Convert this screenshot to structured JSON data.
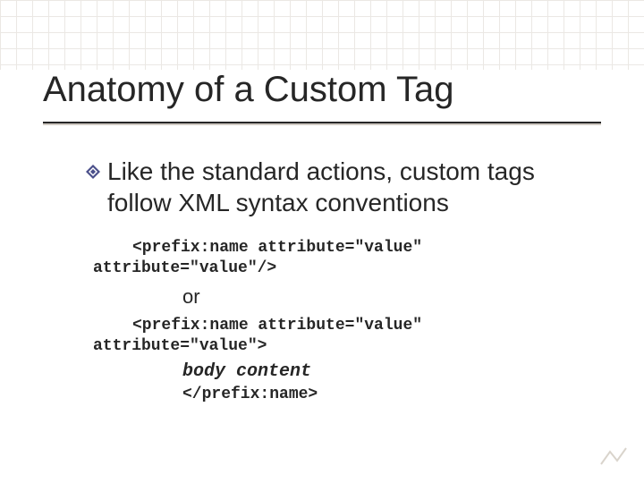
{
  "title": "Anatomy of a Custom Tag",
  "bullet": "Like the standard actions, custom tags follow XML syntax conventions",
  "code": {
    "selfclose_line1": "<prefix:name attribute=\"value\"",
    "selfclose_line2": "attribute=\"value\"/>",
    "or": "or",
    "open_line1": "<prefix:name attribute=\"value\"",
    "open_line2": "attribute=\"value\">",
    "body": "body content",
    "close": "</prefix:name>"
  }
}
